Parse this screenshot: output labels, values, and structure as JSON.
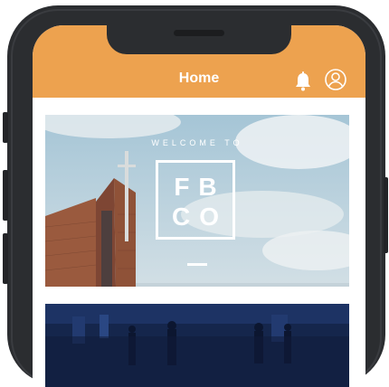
{
  "header": {
    "title": "Home"
  },
  "icons": {
    "bell": "bell-icon",
    "profile": "user-profile-icon"
  },
  "hero": {
    "welcome": "WELCOME TO",
    "logo_line1": "FB",
    "logo_line2": "CO"
  },
  "colors": {
    "header": "#eda24f",
    "frame": "#2b2d30"
  }
}
